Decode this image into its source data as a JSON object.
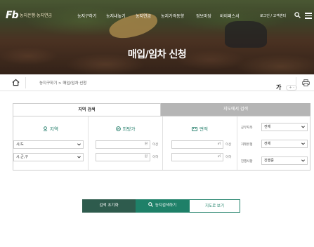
{
  "header": {
    "logo": "Fb",
    "brand": "농지은행·농지연금",
    "nav": [
      "농지구하기",
      "농지내놓기",
      "농지연금",
      "농지가격동향",
      "정보마당",
      "바이패스서"
    ],
    "util": "로그인 / 고객센터",
    "page_title": "매입/임차 신청"
  },
  "breadcrumb": {
    "path": "농지구하기  >  매입/임차 신청",
    "font_size_label": "가",
    "font_size_controls": "+ -"
  },
  "filter": {
    "tabs": [
      "지역 검색",
      "지도에서 검색"
    ],
    "region": {
      "heading": "지역",
      "province": "시/도",
      "city": "시,군,구"
    },
    "price": {
      "heading": "희망가",
      "min_unit": "원",
      "min_suffix": "이상",
      "max_unit": "원",
      "max_suffix": "이하"
    },
    "area": {
      "heading": "면적",
      "min_unit": "㎡",
      "min_suffix": "이상",
      "max_unit": "㎡",
      "max_suffix": "이하"
    },
    "options": [
      {
        "label": "공부지목",
        "value": "전체"
      },
      {
        "label": "거래유형",
        "value": "전체"
      },
      {
        "label": "진행사항",
        "value": "진행중"
      }
    ]
  },
  "buttons": {
    "reset": "검색 초기화",
    "search": "농지검색하기",
    "map": "지도로 보기"
  },
  "colors": {
    "accent": "#1e8068",
    "accent_dark": "#2e5b4d",
    "tab_inactive": "#b5b5b5"
  }
}
